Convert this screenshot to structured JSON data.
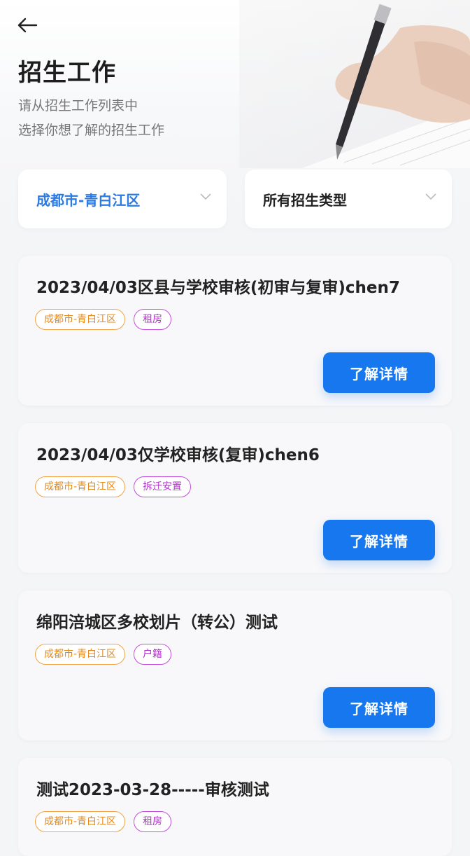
{
  "header": {
    "title": "招生工作",
    "subtitle_line1": "请从招生工作列表中",
    "subtitle_line2": "选择你想了解的招生工作"
  },
  "filters": {
    "region": {
      "value": "成都市-青白江区",
      "color": "#2c7be5"
    },
    "type": {
      "value": "所有招生类型"
    }
  },
  "colors": {
    "primary": "#1677ee",
    "tag_region": "#e48a1d",
    "tag_type": "#b232cc"
  },
  "cards": [
    {
      "title": "2023/04/03区县与学校审核(初审与复审)chen7",
      "tags": [
        "成都市-青白江区",
        "租房"
      ],
      "button": "了解详情"
    },
    {
      "title": "2023/04/03仅学校审核(复审)chen6",
      "tags": [
        "成都市-青白江区",
        "拆迁安置"
      ],
      "button": "了解详情"
    },
    {
      "title": "绵阳涪城区多校划片（转公）测试",
      "tags": [
        "成都市-青白江区",
        "户籍"
      ],
      "button": "了解详情"
    },
    {
      "title": "测试2023-03-28-----审核测试",
      "tags": [
        "成都市-青白江区",
        "租房"
      ]
    }
  ]
}
